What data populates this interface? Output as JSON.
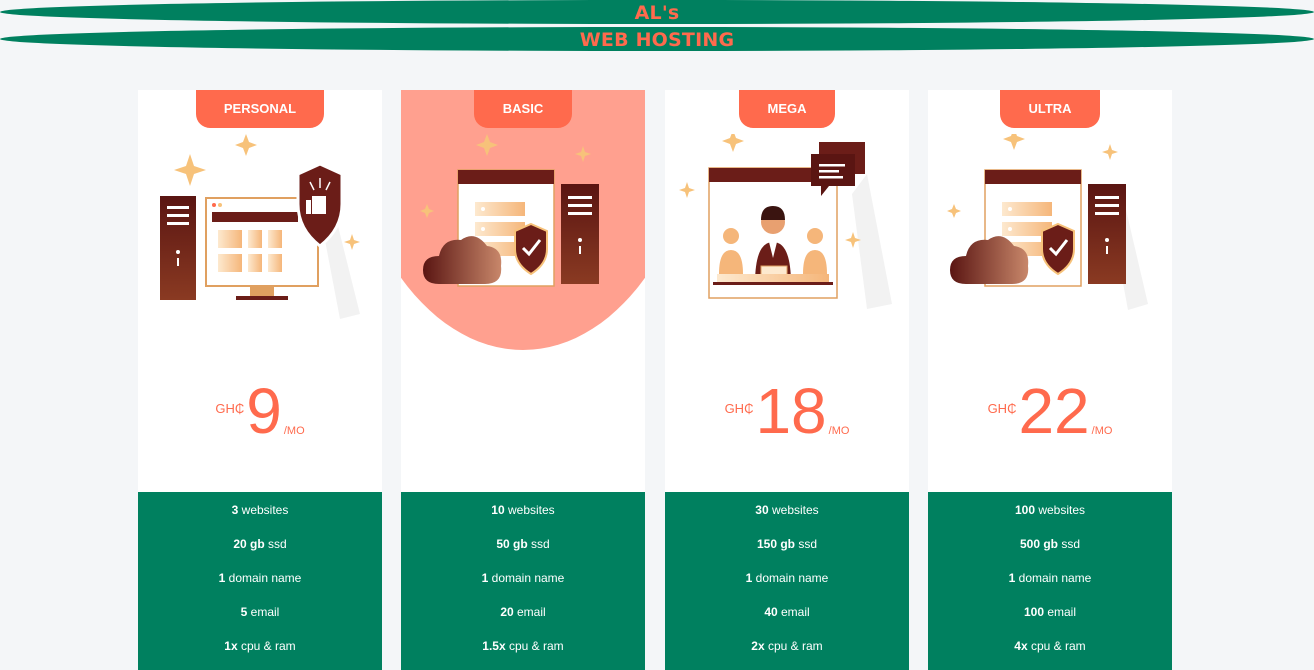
{
  "header": {
    "line1": "AL's",
    "line2": "WEB HOSTING",
    "banner_color": "#00805f",
    "title_color": "#ff6a4d"
  },
  "plans": [
    {
      "name": "PERSONAL",
      "currency": "GH₵",
      "price": "9",
      "period": "/MO",
      "illustration": "monitor-shield-illustration",
      "features": [
        {
          "qty": "3",
          "label": " websites"
        },
        {
          "qty": "20 gb",
          "label": " ssd"
        },
        {
          "qty": "1",
          "label": " domain name"
        },
        {
          "qty": "5",
          "label": " email"
        },
        {
          "qty": "1x",
          "label": " cpu & ram"
        }
      ]
    },
    {
      "name": "BASIC",
      "currency": "",
      "price": "",
      "period": "",
      "highlighted": true,
      "illustration": "server-cloud-shield-illustration",
      "features": [
        {
          "qty": "10",
          "label": " websites"
        },
        {
          "qty": "50 gb",
          "label": " ssd"
        },
        {
          "qty": "1",
          "label": " domain name"
        },
        {
          "qty": "20",
          "label": " email"
        },
        {
          "qty": "1.5x",
          "label": " cpu & ram"
        }
      ]
    },
    {
      "name": "MEGA",
      "currency": "GH₵",
      "price": "18",
      "period": "/MO",
      "illustration": "support-team-illustration",
      "features": [
        {
          "qty": "30",
          "label": " websites"
        },
        {
          "qty": "150 gb",
          "label": " ssd"
        },
        {
          "qty": "1",
          "label": " domain name"
        },
        {
          "qty": "40",
          "label": " email"
        },
        {
          "qty": "2x",
          "label": " cpu & ram"
        }
      ]
    },
    {
      "name": "ULTRA",
      "currency": "GH₵",
      "price": "22",
      "period": "/MO",
      "illustration": "server-cloud-shield-illustration",
      "features": [
        {
          "qty": "100",
          "label": " websites"
        },
        {
          "qty": "500 gb",
          "label": " ssd"
        },
        {
          "qty": "1",
          "label": " domain name"
        },
        {
          "qty": "100",
          "label": " email"
        },
        {
          "qty": "4x",
          "label": " cpu & ram"
        }
      ]
    }
  ],
  "colors": {
    "accent": "#ff6a4d",
    "green": "#00805f",
    "highlight": "#ffa08f",
    "illustration_dark": "#6b1d18"
  }
}
